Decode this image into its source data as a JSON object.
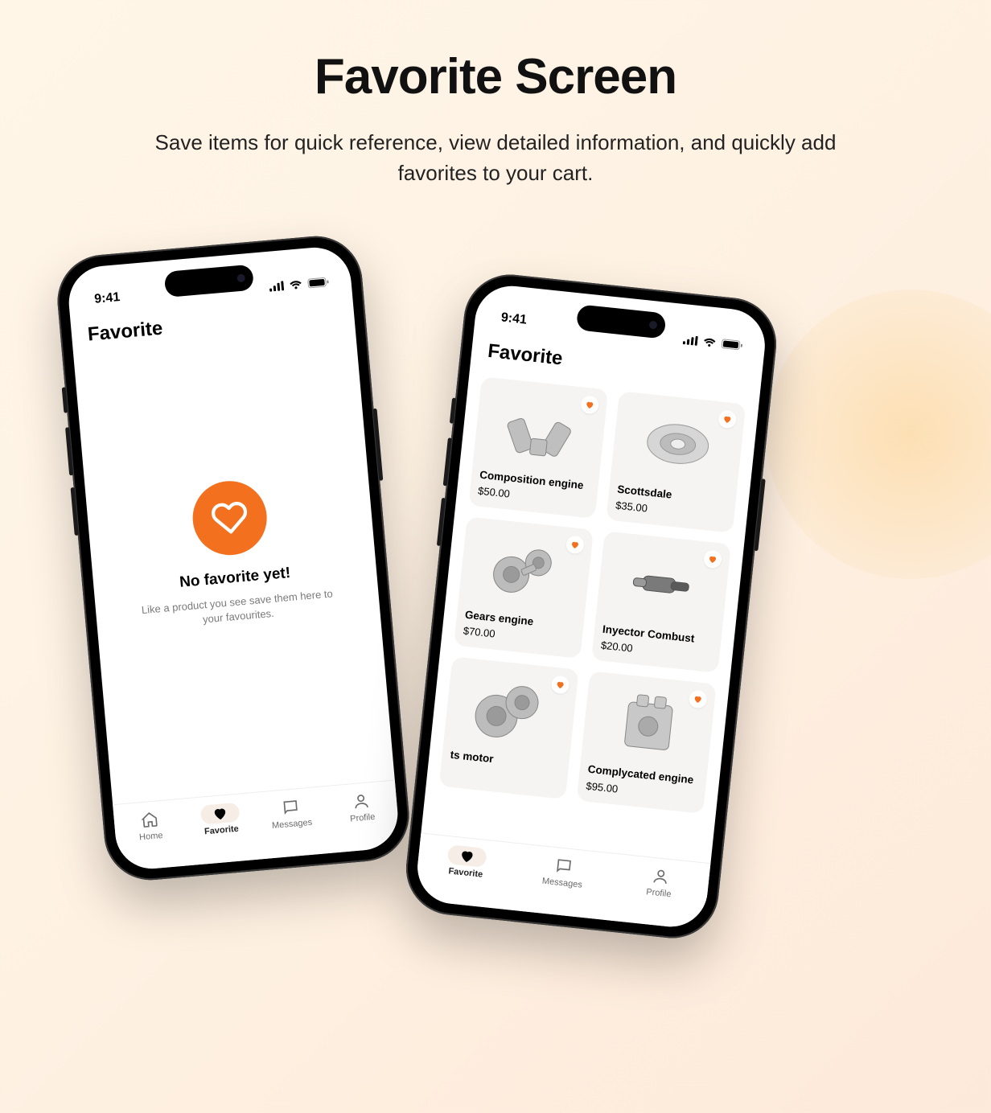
{
  "hero": {
    "title": "Favorite Screen",
    "subtitle": "Save items for quick reference, view detailed information, and quickly add favorites to your cart."
  },
  "status": {
    "time": "9:41"
  },
  "header": {
    "title": "Favorite"
  },
  "empty": {
    "title": "No favorite yet!",
    "subtitle": "Like a product you see save them here to your favourites."
  },
  "products": [
    {
      "name": "Composition engine",
      "price": "$50.00"
    },
    {
      "name": "Scottsdale",
      "price": "$35.00"
    },
    {
      "name": "Gears engine",
      "price": "$70.00"
    },
    {
      "name": "Inyector Combust",
      "price": "$20.00"
    },
    {
      "name": "ts motor",
      "price": ""
    },
    {
      "name": "Complycated engine",
      "price": "$95.00"
    }
  ],
  "tabs": {
    "home": "Home",
    "favorite": "Favorite",
    "messages": "Messages",
    "profile": "Profile"
  }
}
